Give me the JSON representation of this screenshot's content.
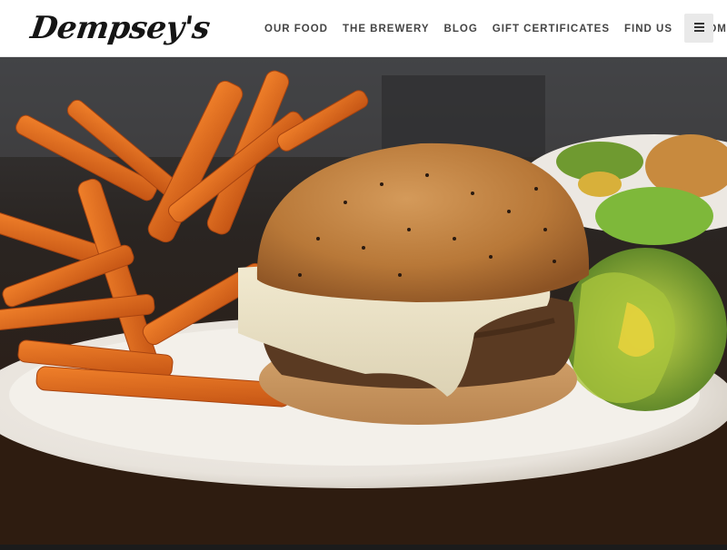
{
  "brand": {
    "name": "Dempsey's"
  },
  "nav": {
    "items": [
      {
        "label": "OUR FOOD"
      },
      {
        "label": "THE BREWERY"
      },
      {
        "label": "BLOG"
      },
      {
        "label": "GIFT CERTIFICATES"
      },
      {
        "label": "FIND US"
      },
      {
        "label": "HOME",
        "icon": "shopping-bag-icon"
      }
    ],
    "toggle_icon": "hamburger-menu-icon"
  },
  "hero": {
    "image_subject": "burger-with-sweet-potato-fries-photo"
  },
  "colors": {
    "nav_background": "#ffffff",
    "nav_text": "#444444",
    "logo": "#151515",
    "toggle_background": "#e9e9e9"
  }
}
